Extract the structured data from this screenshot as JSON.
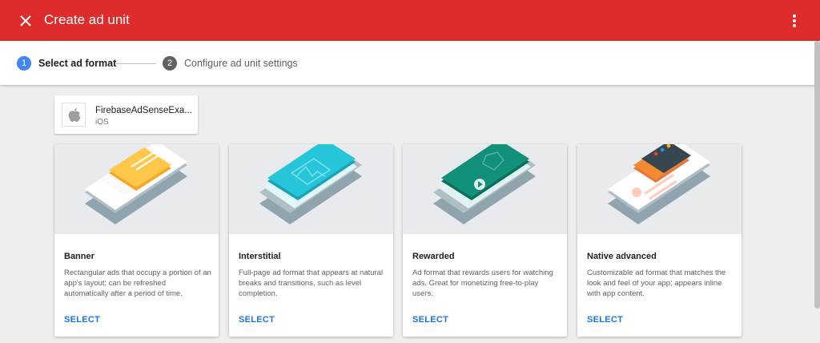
{
  "header": {
    "title": "Create ad unit",
    "close_icon": "close-icon",
    "more_icon": "more-vert-icon",
    "background": "#de2b2b"
  },
  "stepper": {
    "steps": [
      {
        "number": "1",
        "label": "Select ad format",
        "active": true
      },
      {
        "number": "2",
        "label": "Configure ad unit settings",
        "active": false
      }
    ]
  },
  "app": {
    "name": "FirebaseAdSenseExa...",
    "platform": "iOS",
    "icon": "apple-icon"
  },
  "formats": [
    {
      "title": "Banner",
      "description": "Rectangular ads that occupy a portion of an app's layout; can be refreshed automatically after a period of time.",
      "select_label": "SELECT"
    },
    {
      "title": "Interstitial",
      "description": "Full-page ad format that appears at natural breaks and transitions, such as level completion.",
      "select_label": "SELECT"
    },
    {
      "title": "Rewarded",
      "description": "Ad format that rewards users for watching ads. Great for monetizing free-to-play users.",
      "select_label": "SELECT"
    },
    {
      "title": "Native advanced",
      "description": "Customizable ad format that matches the look and feel of your app; appears inline with app content.",
      "select_label": "SELECT"
    }
  ],
  "colors": {
    "accent": "#1a73e8",
    "step_active": "#4285f4",
    "step_inactive": "#616161",
    "banner_accent": "#f5a623",
    "interstitial_accent": "#26b5c9",
    "rewarded_accent": "#0f8a74",
    "native_accent": "#f28b31"
  }
}
